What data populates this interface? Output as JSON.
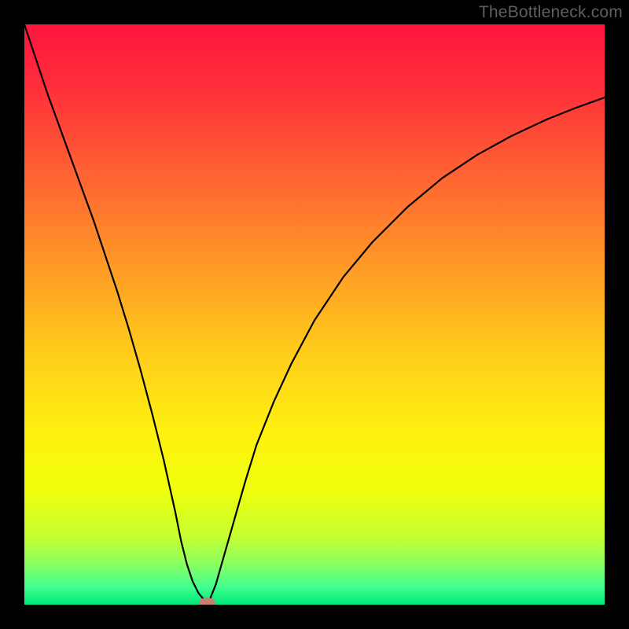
{
  "watermark": "TheBottleneck.com",
  "chart_data": {
    "type": "line",
    "title": "",
    "xlabel": "",
    "ylabel": "",
    "xlim": [
      0,
      100
    ],
    "ylim": [
      0,
      100
    ],
    "grid": false,
    "axes_visible": false,
    "background_gradient": {
      "stops": [
        {
          "offset": 0,
          "color": "#ff153f"
        },
        {
          "offset": 0.1,
          "color": "#ff2c3b"
        },
        {
          "offset": 0.25,
          "color": "#ff6033"
        },
        {
          "offset": 0.4,
          "color": "#ff9428"
        },
        {
          "offset": 0.55,
          "color": "#ffc81c"
        },
        {
          "offset": 0.7,
          "color": "#fff010"
        },
        {
          "offset": 0.8,
          "color": "#f0ff0a"
        },
        {
          "offset": 0.88,
          "color": "#c8ff30"
        },
        {
          "offset": 0.93,
          "color": "#8aff60"
        },
        {
          "offset": 0.97,
          "color": "#40ff90"
        },
        {
          "offset": 1.0,
          "color": "#00e878"
        }
      ]
    },
    "series": [
      {
        "name": "bottleneck-curve",
        "color": "#000000",
        "width": 2.2,
        "x": [
          0,
          2,
          4,
          6,
          8,
          10,
          12,
          14,
          16,
          18,
          20,
          22,
          24,
          26,
          27,
          28,
          29,
          30,
          31,
          31.5,
          32,
          33,
          34,
          36,
          38,
          40,
          43,
          46,
          50,
          55,
          60,
          66,
          72,
          78,
          84,
          90,
          95,
          100
        ],
        "y": [
          100,
          94,
          88,
          82.5,
          77,
          71.5,
          66,
          60,
          54,
          47.5,
          40.5,
          33,
          25,
          16,
          11,
          7,
          4,
          2,
          0.8,
          0.3,
          1,
          3.5,
          7,
          14,
          21,
          27.5,
          35,
          41.5,
          49,
          56.5,
          62.5,
          68.5,
          73.5,
          77.5,
          80.8,
          83.6,
          85.6,
          87.4
        ]
      }
    ],
    "marker": {
      "name": "optimal-point",
      "x": 31.5,
      "y": 0.3,
      "rx": 1.4,
      "ry": 0.9,
      "color": "#c97f74"
    }
  }
}
